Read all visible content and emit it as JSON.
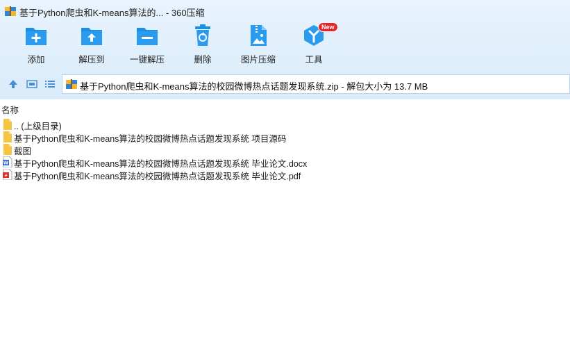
{
  "window": {
    "title": "基于Python爬虫和K-means算法的... - 360压缩"
  },
  "toolbar": {
    "items": [
      {
        "label": "添加",
        "icon": "add-folder-icon"
      },
      {
        "label": "解压到",
        "icon": "extract-to-icon"
      },
      {
        "label": "一键解压",
        "icon": "one-click-extract-icon"
      },
      {
        "label": "删除",
        "icon": "trash-icon"
      },
      {
        "label": "图片压缩",
        "icon": "image-compress-icon"
      },
      {
        "label": "工具",
        "icon": "tools-icon",
        "badge": "New"
      }
    ]
  },
  "address": {
    "path": "基于Python爬虫和K-means算法的校园微博热点话题发现系统.zip - 解包大小为 13.7 MB"
  },
  "columns": {
    "name": "名称"
  },
  "files": [
    {
      "name": ".. (上级目录)",
      "type": "folder"
    },
    {
      "name": "基于Python爬虫和K-means算法的校园微博热点话题发现系统 项目源码",
      "type": "folder"
    },
    {
      "name": "截图",
      "type": "folder"
    },
    {
      "name": "基于Python爬虫和K-means算法的校园微博热点话题发现系统 毕业论文.docx",
      "type": "docx"
    },
    {
      "name": "基于Python爬虫和K-means算法的校园微博热点话题发现系统 毕业论文.pdf",
      "type": "pdf"
    }
  ],
  "colors": {
    "accent": "#1e8fe0",
    "folder": "#f5c542",
    "badge": "#e5252a"
  }
}
